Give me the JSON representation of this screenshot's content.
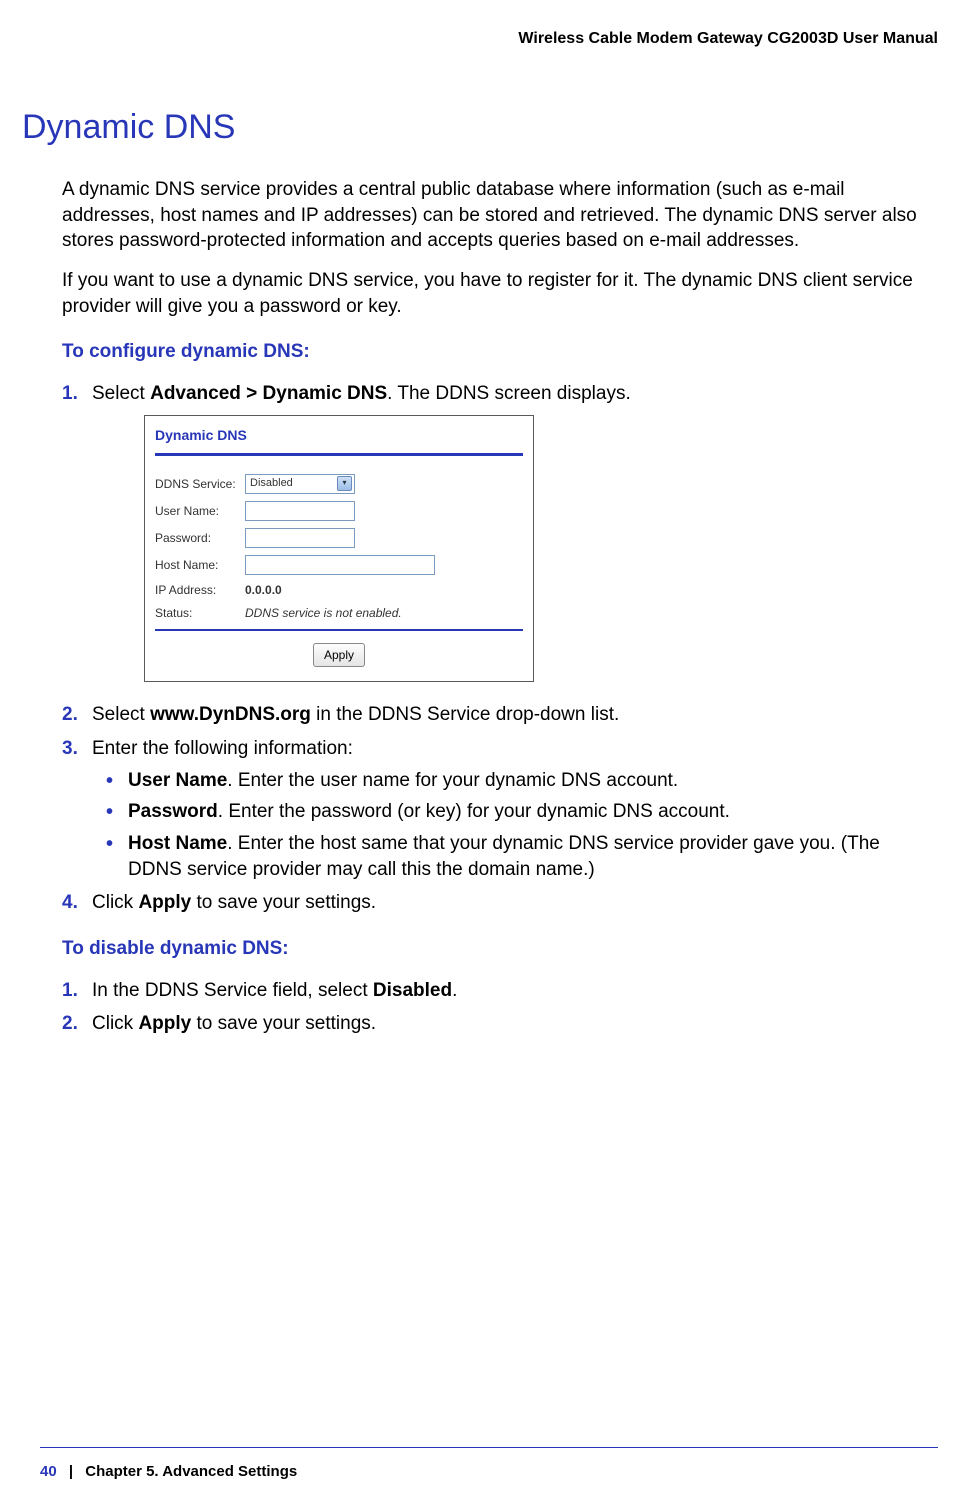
{
  "header": {
    "doc_title": "Wireless Cable Modem Gateway CG2003D User Manual"
  },
  "section": {
    "title": "Dynamic DNS"
  },
  "paragraphs": {
    "p1": "A dynamic DNS service provides a central public database where information (such as e-mail addresses, host names and IP addresses) can be stored and retrieved. The dynamic DNS server also stores password-protected information and accepts queries based on e-mail addresses.",
    "p2": "If you want to use a dynamic DNS service, you have to register for it. The dynamic DNS client service provider will give you a password or key."
  },
  "subheadings": {
    "configure": "To configure dynamic DNS:",
    "disable": "To disable dynamic DNS:"
  },
  "steps_configure": {
    "s1_num": "1.",
    "s1_pre": "Select ",
    "s1_bold": "Advanced > Dynamic DNS",
    "s1_post": ". The DDNS screen displays.",
    "s2_num": "2.",
    "s2_pre": "Select ",
    "s2_bold": "www.DynDNS.org",
    "s2_post": " in the DDNS Service drop-down list.",
    "s3_num": "3.",
    "s3_text": "Enter the following information:",
    "s3a_bold": "User Name",
    "s3a_post": ". Enter the user name for your dynamic DNS account.",
    "s3b_bold": "Password",
    "s3b_post": ". Enter the password (or key) for your dynamic DNS account.",
    "s3c_bold": "Host Name",
    "s3c_post": ". Enter the host same that your dynamic DNS service provider gave you. (The DDNS service provider may call this the domain name.)",
    "s4_num": "4.",
    "s4_pre": "Click ",
    "s4_bold": "Apply",
    "s4_post": " to save your settings."
  },
  "steps_disable": {
    "s1_num": "1.",
    "s1_pre": "In the DDNS Service field, select ",
    "s1_bold": "Disabled",
    "s1_post": ".",
    "s2_num": "2.",
    "s2_pre": "Click ",
    "s2_bold": "Apply",
    "s2_post": " to save your settings."
  },
  "screenshot": {
    "title": "Dynamic DNS",
    "rows": {
      "ddns_label": "DDNS Service:",
      "ddns_value": "Disabled",
      "user_label": "User Name:",
      "pass_label": "Password:",
      "host_label": "Host Name:",
      "ip_label": "IP Address:",
      "ip_value": "0.0.0.0",
      "status_label": "Status:",
      "status_value": "DDNS service is not enabled."
    },
    "apply": "Apply"
  },
  "footer": {
    "page": "40",
    "sep": "|",
    "chapter": "Chapter 5.  Advanced Settings"
  },
  "bullet": "•"
}
